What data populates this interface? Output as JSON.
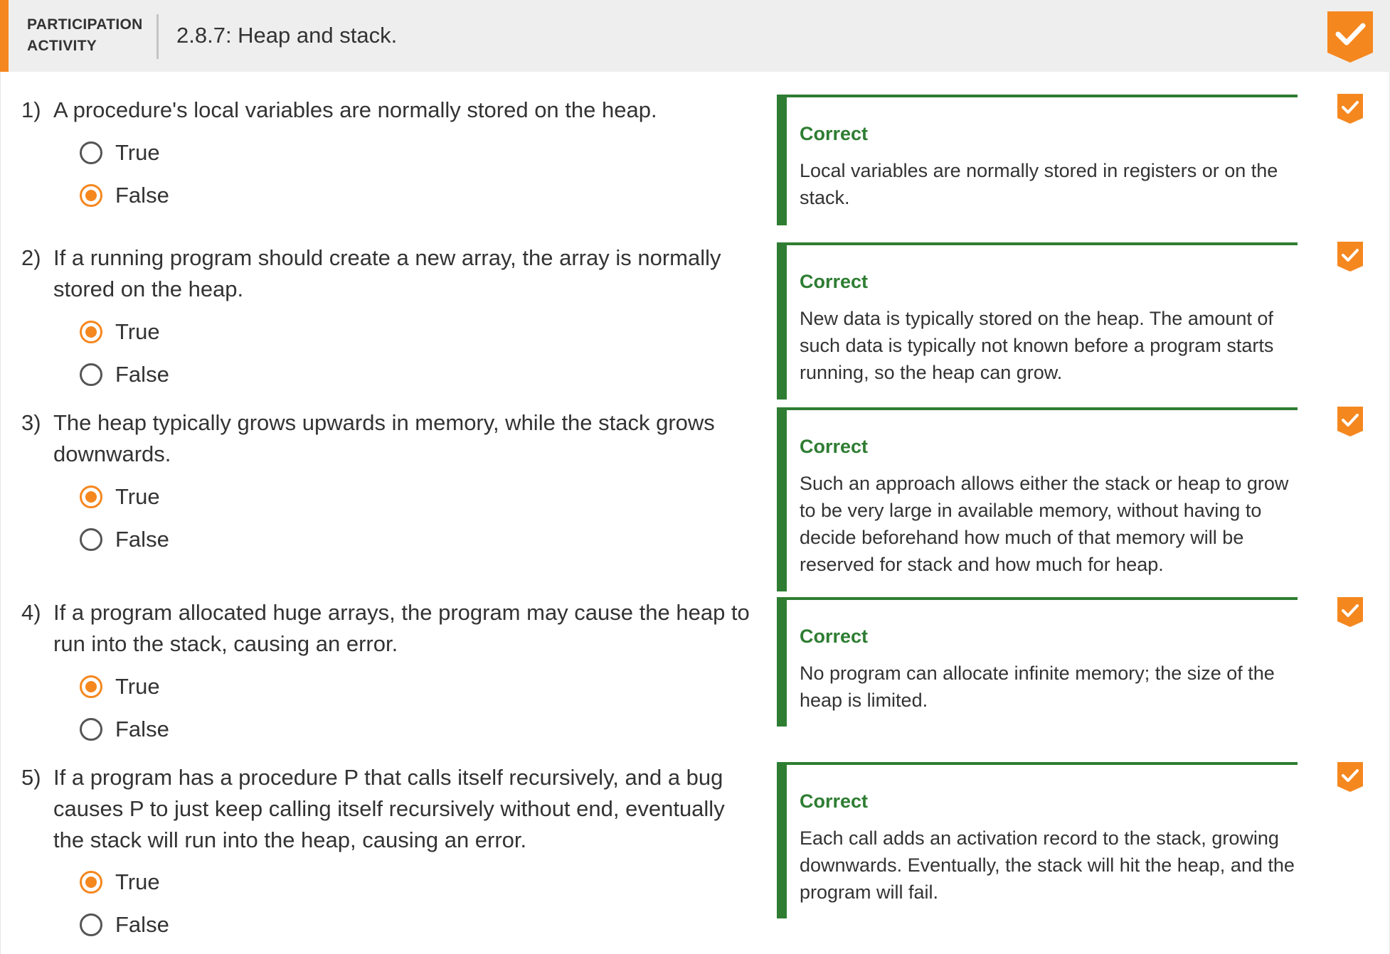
{
  "header": {
    "label": "PARTICIPATION ACTIVITY",
    "title": "2.8.7: Heap and stack."
  },
  "colors": {
    "accent": "#f5871f",
    "correct": "#2e7d32",
    "header_bg": "#eeeeee"
  },
  "questions": [
    {
      "number": "1)",
      "text": "A procedure's local variables are normally stored on the heap.",
      "options": [
        {
          "label": "True",
          "selected": false
        },
        {
          "label": "False",
          "selected": true
        }
      ],
      "feedback": {
        "title": "Correct",
        "text": "Local variables are normally stored in registers or on the stack."
      }
    },
    {
      "number": "2)",
      "text": "If a running program should create a new array, the array is normally stored on the heap.",
      "options": [
        {
          "label": "True",
          "selected": true
        },
        {
          "label": "False",
          "selected": false
        }
      ],
      "feedback": {
        "title": "Correct",
        "text": "New data is typically stored on the heap. The amount of such data is typically not known before a program starts running, so the heap can grow."
      }
    },
    {
      "number": "3)",
      "text": "The heap typically grows upwards in memory, while the stack grows downwards.",
      "options": [
        {
          "label": "True",
          "selected": true
        },
        {
          "label": "False",
          "selected": false
        }
      ],
      "feedback": {
        "title": "Correct",
        "text": "Such an approach allows either the stack or heap to grow to be very large in available memory, without having to decide beforehand how much of that memory will be reserved for stack and how much for heap."
      }
    },
    {
      "number": "4)",
      "text": "If a program allocated huge arrays, the program may cause the heap to run into the stack, causing an error.",
      "options": [
        {
          "label": "True",
          "selected": true
        },
        {
          "label": "False",
          "selected": false
        }
      ],
      "feedback": {
        "title": "Correct",
        "text": "No program can allocate infinite memory; the size of the heap is limited."
      }
    },
    {
      "number": "5)",
      "text": "If a program has a procedure P that calls itself recursively, and a bug causes P to just keep calling itself recursively without end, eventually the stack will run into the heap, causing an error.",
      "options": [
        {
          "label": "True",
          "selected": true
        },
        {
          "label": "False",
          "selected": false
        }
      ],
      "feedback": {
        "title": "Correct",
        "text": "Each call adds an activation record to the stack, growing downwards. Eventually, the stack will hit the heap, and the program will fail."
      }
    }
  ]
}
